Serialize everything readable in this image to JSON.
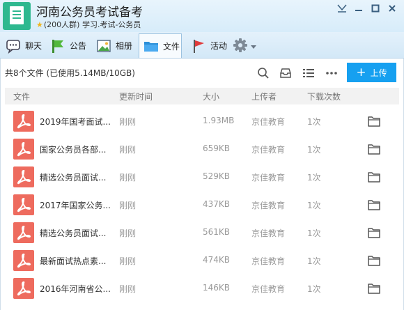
{
  "group": {
    "name": "河南公务员考试备考",
    "member_count": "(200人群)",
    "tags": "学习.考试-公务员"
  },
  "tabs": [
    {
      "label": "聊天",
      "icon": "chat-icon"
    },
    {
      "label": "公告",
      "icon": "announcement-icon"
    },
    {
      "label": "相册",
      "icon": "photo-album-icon"
    },
    {
      "label": "文件",
      "icon": "folder-icon",
      "active": true
    },
    {
      "label": "活动",
      "icon": "flag-icon"
    }
  ],
  "files": {
    "summary": "共8个文件 (已使用5.14MB/10GB)",
    "upload_label": "上传",
    "columns": [
      "文件",
      "更新时间",
      "大小",
      "上传者",
      "下载次数"
    ],
    "rows": [
      {
        "name": "2019年国考面试...",
        "time": "刚刚",
        "size": "1.93MB",
        "uploader": "京佳教育",
        "downloads": "1次"
      },
      {
        "name": "国家公务员各部...",
        "time": "刚刚",
        "size": "659KB",
        "uploader": "京佳教育",
        "downloads": "1次"
      },
      {
        "name": "精选公务员面试...",
        "time": "刚刚",
        "size": "529KB",
        "uploader": "京佳教育",
        "downloads": "1次"
      },
      {
        "name": "2017年国家公务...",
        "time": "刚刚",
        "size": "437KB",
        "uploader": "京佳教育",
        "downloads": "1次"
      },
      {
        "name": "精选公务员面试...",
        "time": "刚刚",
        "size": "561KB",
        "uploader": "京佳教育",
        "downloads": "1次"
      },
      {
        "name": "最新面试热点素...",
        "time": "刚刚",
        "size": "474KB",
        "uploader": "京佳教育",
        "downloads": "1次"
      },
      {
        "name": "2016年河南省公...",
        "time": "刚刚",
        "size": "146KB",
        "uploader": "京佳教育",
        "downloads": "1次"
      }
    ]
  },
  "colors": {
    "accent": "#16a0f0",
    "pdf": "#ee6b5e",
    "logo": "#2eb88f"
  }
}
